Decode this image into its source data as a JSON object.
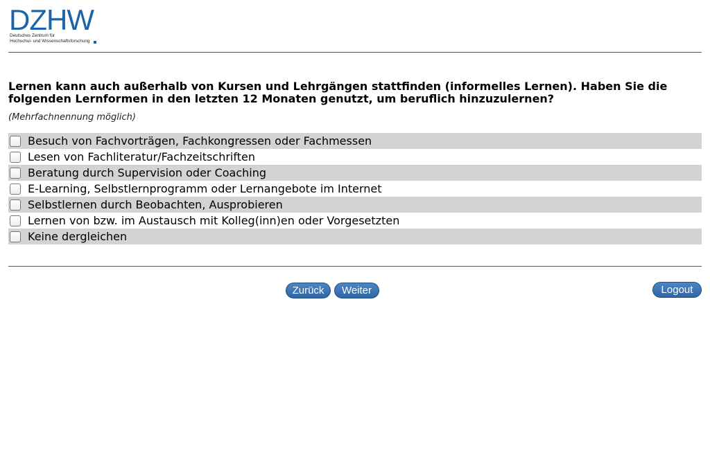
{
  "header": {
    "logo": {
      "mark": "DZHW",
      "line1": "Deutsches Zentrum für",
      "line2": "Hochschul- und Wissenschaftsforschung"
    }
  },
  "survey": {
    "question": "Lernen kann auch außerhalb von Kursen und Lehrgängen stattfinden (informelles Lernen). Haben Sie die folgenden Lernformen in den letzten 12 Monaten genutzt, um beruflich hinzuzulernen?",
    "hint": "(Mehrfachnennung möglich)",
    "options": [
      {
        "label": "Besuch von Fachvorträgen, Fachkongressen oder Fachmessen",
        "checked": false
      },
      {
        "label": "Lesen von Fachliteratur/Fachzeitschriften",
        "checked": false
      },
      {
        "label": "Beratung durch Supervision oder Coaching",
        "checked": false
      },
      {
        "label": "E-Learning, Selbstlernprogramm oder Lernangebote im Internet",
        "checked": false
      },
      {
        "label": "Selbstlernen durch Beobachten, Ausprobieren",
        "checked": false
      },
      {
        "label": "Lernen von bzw. im Austausch mit Kolleg(inn)en oder Vorgesetzten",
        "checked": false
      },
      {
        "label": "Keine dergleichen",
        "checked": false
      }
    ]
  },
  "navigation": {
    "back_label": "Zurück",
    "next_label": "Weiter",
    "logout_label": "Logout"
  },
  "colors": {
    "brand": "#1c64a8",
    "button": "#2f65a7",
    "row_stripe": "#d3d3d3"
  }
}
